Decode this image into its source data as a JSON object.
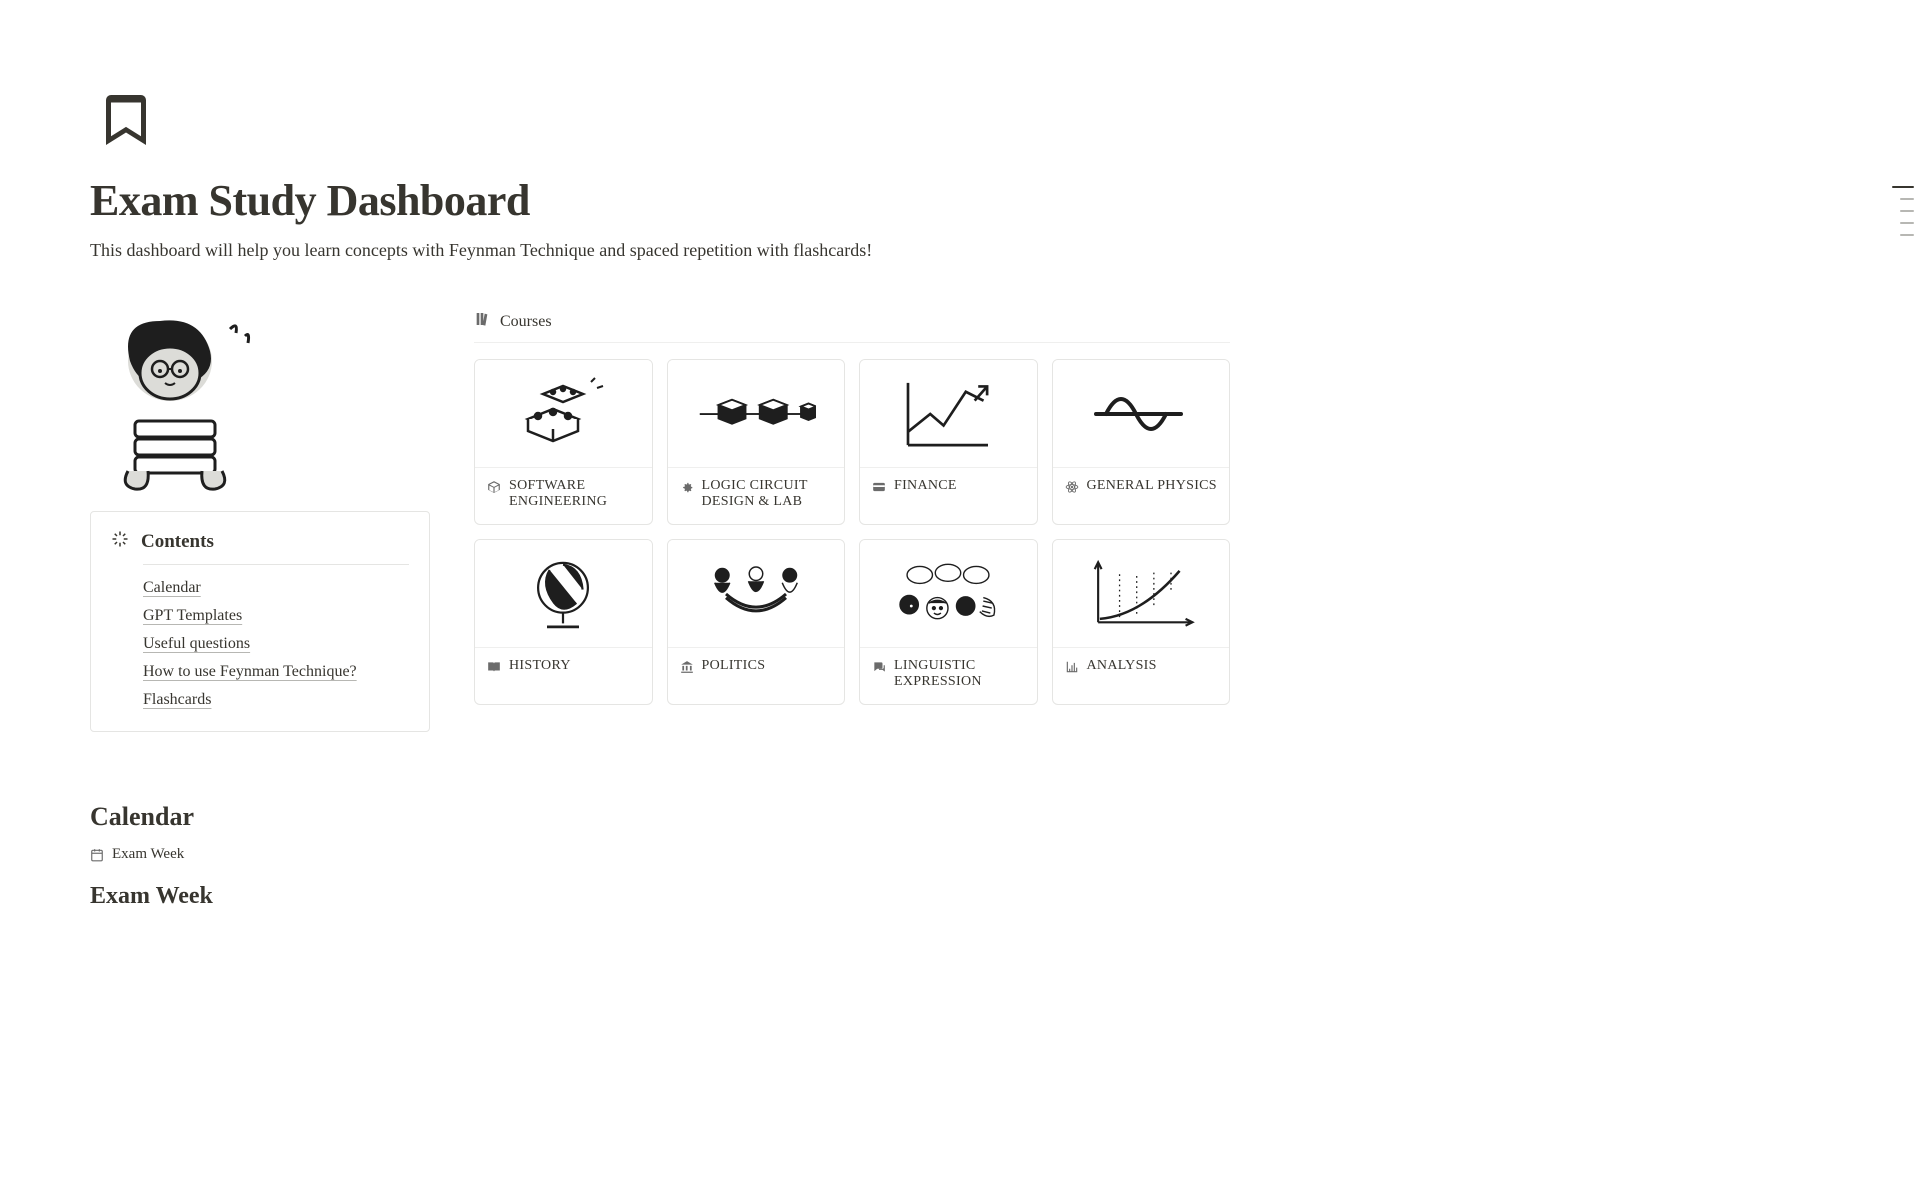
{
  "title": "Exam Study Dashboard",
  "subtitle": "This dashboard will help you learn concepts with Feynman Technique and spaced repetition with flashcards!",
  "contents": {
    "heading": "Contents",
    "links": [
      "Calendar",
      "GPT Templates",
      "Useful questions",
      "How to use Feynman Technique?",
      "Flashcards"
    ]
  },
  "courses": {
    "heading": "Courses",
    "items": [
      {
        "label": "SOFTWARE ENGINEERING",
        "icon": "cube-icon"
      },
      {
        "label": "LOGIC CIRCUIT DESIGN & LAB",
        "icon": "gear-icon"
      },
      {
        "label": "FINANCE",
        "icon": "card-icon"
      },
      {
        "label": "GENERAL PHYSICS",
        "icon": "atom-icon"
      },
      {
        "label": "HISTORY",
        "icon": "book-open-icon"
      },
      {
        "label": "POLITICS",
        "icon": "institution-icon"
      },
      {
        "label": "LINGUISTIC EXPRESSION",
        "icon": "chat-icon"
      },
      {
        "label": "ANALYSIS",
        "icon": "chart-icon"
      }
    ]
  },
  "calendar": {
    "heading": "Calendar",
    "tab": "Exam Week",
    "week_title": "Exam Week"
  }
}
